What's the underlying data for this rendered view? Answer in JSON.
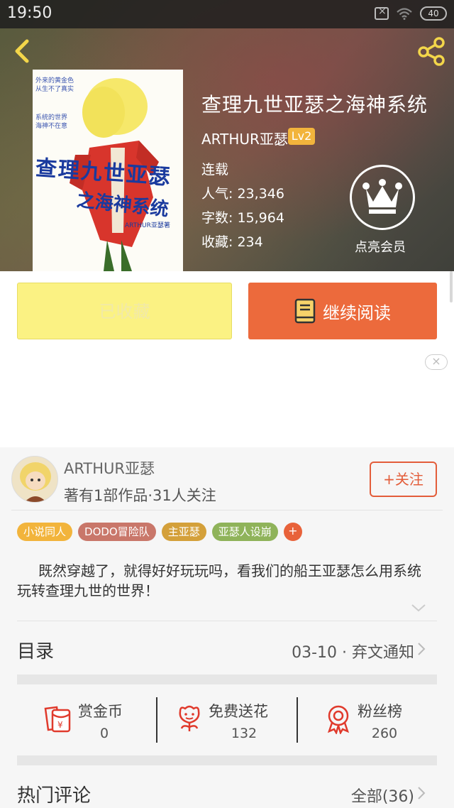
{
  "status_bar": {
    "time": "19:50",
    "battery": "40"
  },
  "book": {
    "title": "查理九世亚瑟之海神系统",
    "author": "ARTHUR亚瑟",
    "level": "Lv2",
    "status": "连载",
    "popularity": "人气: 23,346",
    "word_count": "字数: 15,964",
    "favorites": "收藏: 234",
    "cover_title_line1": "查理九世亚瑟",
    "cover_title_line2": "之海神系统",
    "cover_author": "ARTHUR亚瑟著"
  },
  "vip": {
    "label": "点亮会员"
  },
  "actions": {
    "collected_label": "已收藏",
    "read_label": "继续阅读"
  },
  "ad": {
    "close": "×"
  },
  "author_card": {
    "name": "ARTHUR亚瑟",
    "stats": "著有1部作品·31人关注",
    "follow_label": "+关注"
  },
  "tags": [
    {
      "label": "小说同人",
      "color": "#f2b43c"
    },
    {
      "label": "DODO冒险队",
      "color": "#c9776a"
    },
    {
      "label": "主亚瑟",
      "color": "#d4a03a"
    },
    {
      "label": "亚瑟人设崩",
      "color": "#8fb35a"
    }
  ],
  "tag_add": "+",
  "intro": "既然穿越了，就得好好玩玩吗，看我们的船王亚瑟怎么用系统玩转查理九世的世界！",
  "toc": {
    "label": "目录",
    "latest": "03-10 · 弃文通知"
  },
  "gifts": [
    {
      "name": "赏金币",
      "value": "0"
    },
    {
      "name": "免费送花",
      "value": "132"
    },
    {
      "name": "粉丝榜",
      "value": "260"
    }
  ],
  "comments": {
    "label": "热门评论",
    "all": "全部(36)"
  },
  "colors": {
    "accent": "#ec6a3c",
    "collected_bg": "#fbf283",
    "badge": "#f2b43c"
  }
}
